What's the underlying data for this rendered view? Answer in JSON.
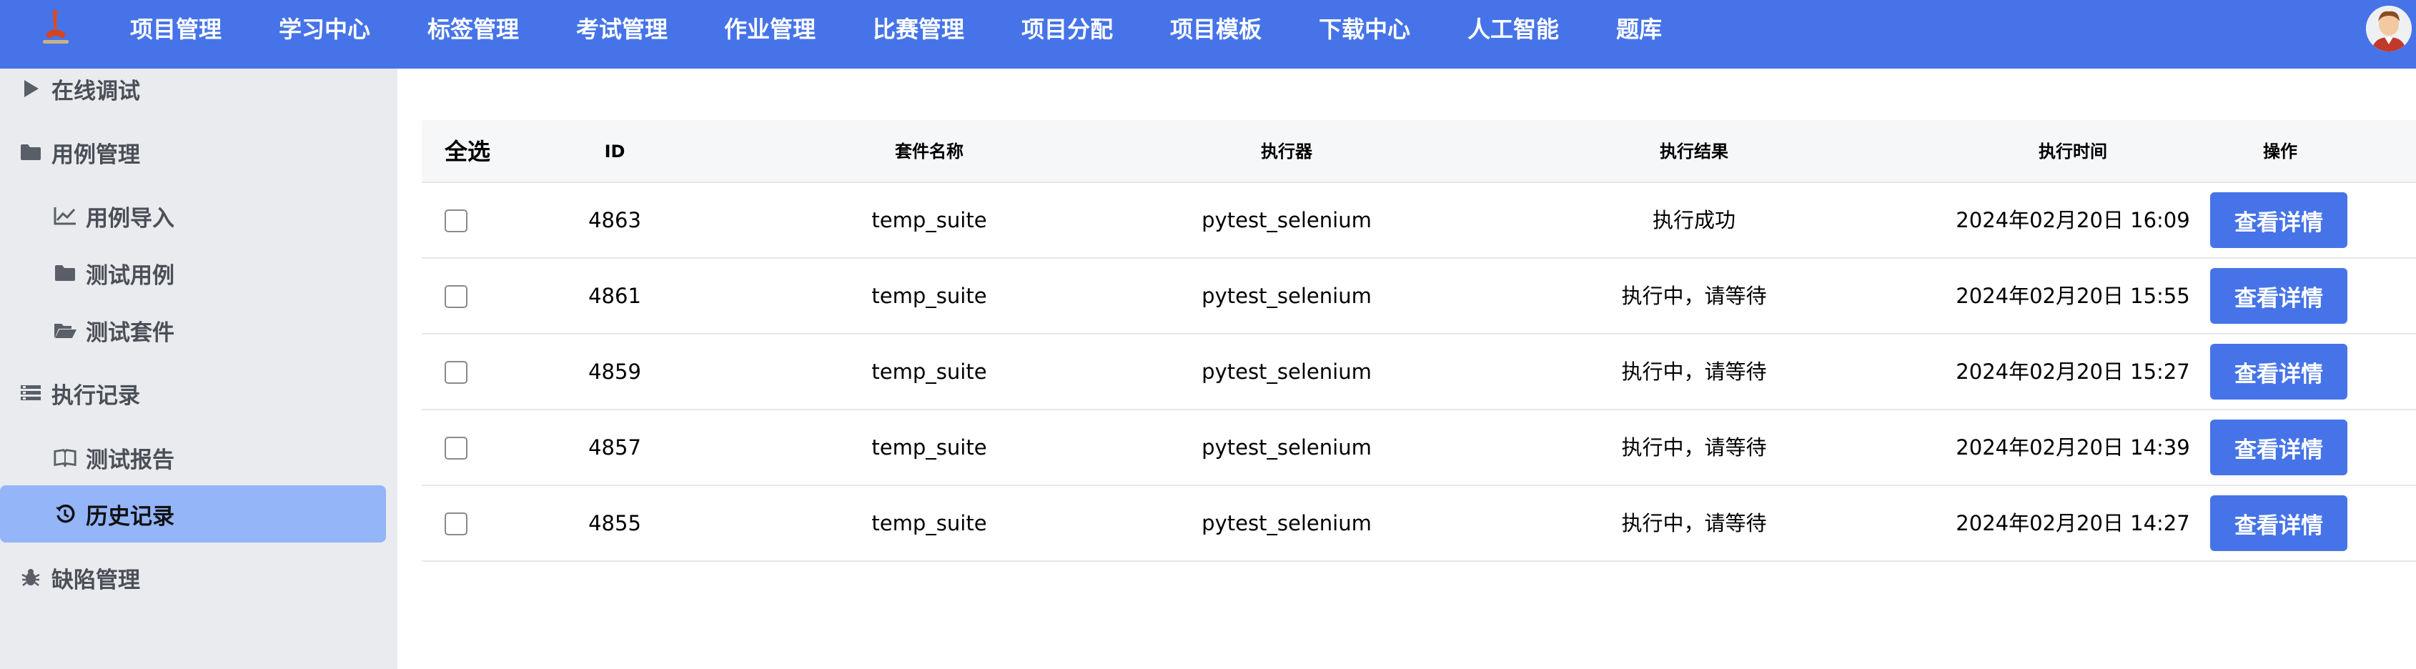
{
  "nav": {
    "items": [
      "项目管理",
      "学习中心",
      "标签管理",
      "考试管理",
      "作业管理",
      "比赛管理",
      "项目分配",
      "项目模板",
      "下载中心",
      "人工智能",
      "题库"
    ]
  },
  "sidebar": {
    "items": [
      {
        "label": "在线调试",
        "icon": "play-triangle-icon",
        "kind": "group"
      },
      {
        "label": "用例管理",
        "icon": "folder-icon",
        "kind": "group"
      },
      {
        "label": "用例导入",
        "icon": "line-chart-icon",
        "kind": "sub"
      },
      {
        "label": "测试用例",
        "icon": "folder-icon",
        "kind": "sub"
      },
      {
        "label": "测试套件",
        "icon": "folder-open-icon",
        "kind": "sub"
      },
      {
        "label": "执行记录",
        "icon": "list-icon",
        "kind": "group"
      },
      {
        "label": "测试报告",
        "icon": "book-icon",
        "kind": "sub"
      },
      {
        "label": "历史记录",
        "icon": "history-icon",
        "kind": "sub",
        "active": true
      },
      {
        "label": "缺陷管理",
        "icon": "bug-icon",
        "kind": "group"
      }
    ]
  },
  "table": {
    "select_all": "全选",
    "headers": {
      "id": "ID",
      "suite": "套件名称",
      "executor": "执行器",
      "result": "执行结果",
      "time": "执行时间",
      "operation": "操作"
    },
    "button_label": "查看详情",
    "rows": [
      {
        "id": "4863",
        "suite": "temp_suite",
        "executor": "pytest_selenium",
        "result": "执行成功",
        "time": "2024年02月20日 16:09"
      },
      {
        "id": "4861",
        "suite": "temp_suite",
        "executor": "pytest_selenium",
        "result": "执行中，请等待",
        "time": "2024年02月20日 15:55"
      },
      {
        "id": "4859",
        "suite": "temp_suite",
        "executor": "pytest_selenium",
        "result": "执行中，请等待",
        "time": "2024年02月20日 15:27"
      },
      {
        "id": "4857",
        "suite": "temp_suite",
        "executor": "pytest_selenium",
        "result": "执行中，请等待",
        "time": "2024年02月20日 14:39"
      },
      {
        "id": "4855",
        "suite": "temp_suite",
        "executor": "pytest_selenium",
        "result": "执行中，请等待",
        "time": "2024年02月20日 14:27"
      }
    ]
  },
  "colors": {
    "primary": "#4674e8",
    "sidebar_bg": "#e9ebee",
    "sidebar_active": "#94b5f8",
    "header_bg": "#f6f7f9"
  }
}
